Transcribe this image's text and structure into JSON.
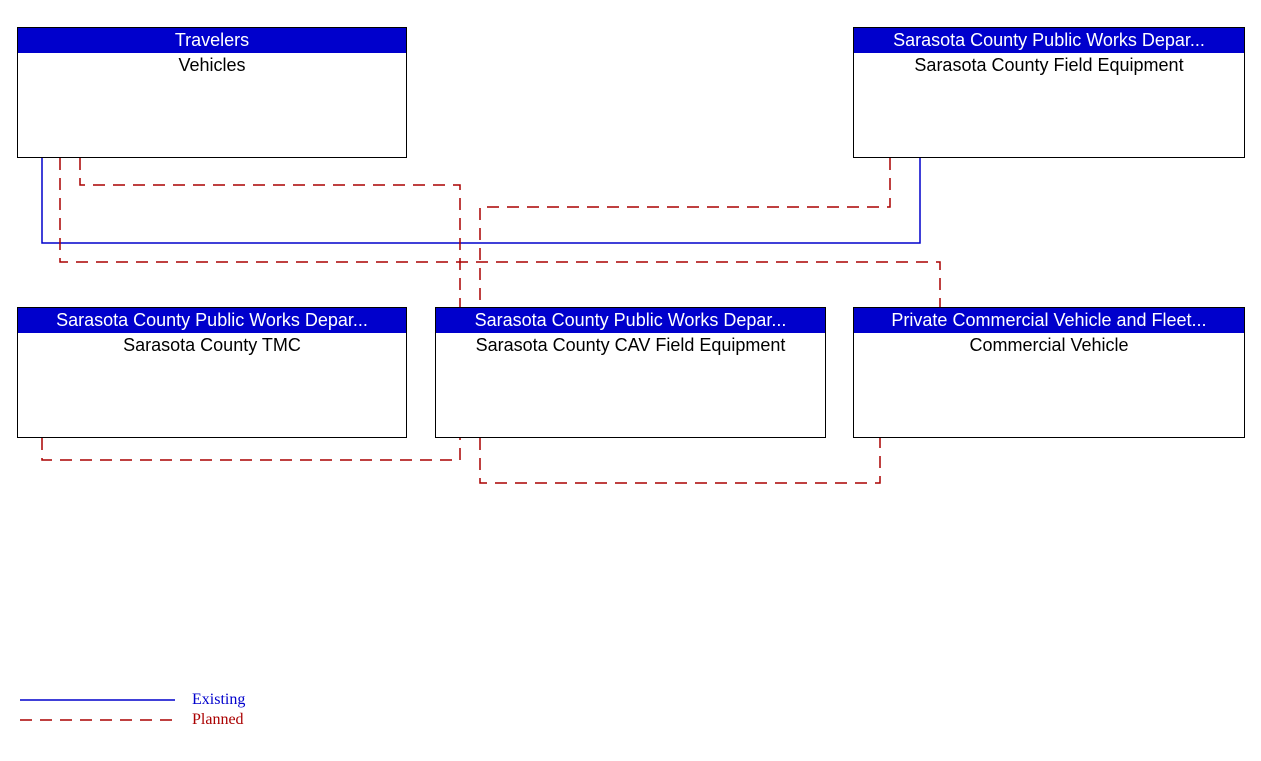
{
  "nodes": {
    "travelers": {
      "header": "Travelers",
      "body": "Vehicles"
    },
    "sarasota_field_equipment": {
      "header": "Sarasota County Public Works Depar...",
      "body": "Sarasota County Field Equipment"
    },
    "sarasota_tmc": {
      "header": "Sarasota County Public Works Depar...",
      "body": "Sarasota County TMC"
    },
    "sarasota_cav": {
      "header": "Sarasota County Public Works Depar...",
      "body": "Sarasota County CAV Field Equipment"
    },
    "commercial_vehicle": {
      "header": "Private Commercial Vehicle and Fleet...",
      "body": "Commercial Vehicle"
    }
  },
  "legend": {
    "existing": "Existing",
    "planned": "Planned"
  },
  "colors": {
    "header_bg": "#0000cc",
    "existing_line": "#0000cc",
    "planned_line": "#aa0000"
  },
  "chart_data": {
    "type": "diagram",
    "title": "",
    "nodes": [
      {
        "id": "vehicles",
        "stakeholder": "Travelers",
        "element": "Vehicles"
      },
      {
        "id": "field_equipment",
        "stakeholder": "Sarasota County Public Works Department",
        "element": "Sarasota County Field Equipment"
      },
      {
        "id": "tmc",
        "stakeholder": "Sarasota County Public Works Department",
        "element": "Sarasota County TMC"
      },
      {
        "id": "cav",
        "stakeholder": "Sarasota County Public Works Department",
        "element": "Sarasota County CAV Field Equipment"
      },
      {
        "id": "commercial_vehicle",
        "stakeholder": "Private Commercial Vehicle and Fleet Operators",
        "element": "Commercial Vehicle"
      }
    ],
    "edges": [
      {
        "from": "vehicles",
        "to": "field_equipment",
        "status": "existing"
      },
      {
        "from": "vehicles",
        "to": "cav",
        "status": "planned"
      },
      {
        "from": "vehicles",
        "to": "commercial_vehicle",
        "status": "planned"
      },
      {
        "from": "field_equipment",
        "to": "cav",
        "status": "planned"
      },
      {
        "from": "tmc",
        "to": "cav",
        "status": "planned"
      },
      {
        "from": "cav",
        "to": "commercial_vehicle",
        "status": "planned"
      }
    ],
    "legend": [
      {
        "label": "Existing",
        "style": "solid",
        "color": "#0000cc"
      },
      {
        "label": "Planned",
        "style": "dashed",
        "color": "#aa0000"
      }
    ]
  }
}
